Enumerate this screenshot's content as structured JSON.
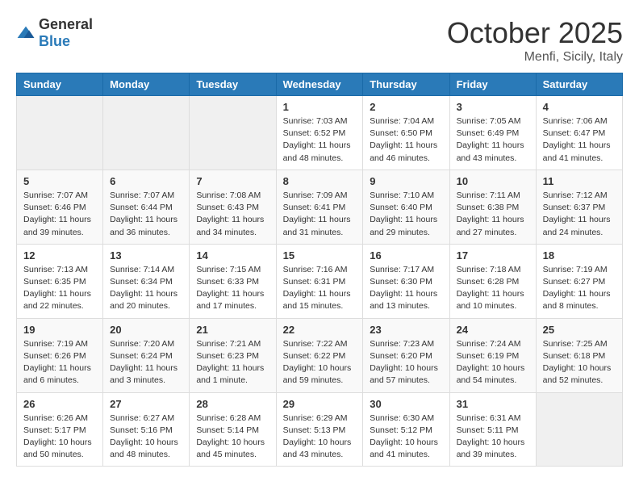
{
  "header": {
    "logo_general": "General",
    "logo_blue": "Blue",
    "month": "October 2025",
    "location": "Menfi, Sicily, Italy"
  },
  "weekdays": [
    "Sunday",
    "Monday",
    "Tuesday",
    "Wednesday",
    "Thursday",
    "Friday",
    "Saturday"
  ],
  "weeks": [
    [
      {
        "day": "",
        "info": ""
      },
      {
        "day": "",
        "info": ""
      },
      {
        "day": "",
        "info": ""
      },
      {
        "day": "1",
        "info": "Sunrise: 7:03 AM\nSunset: 6:52 PM\nDaylight: 11 hours\nand 48 minutes."
      },
      {
        "day": "2",
        "info": "Sunrise: 7:04 AM\nSunset: 6:50 PM\nDaylight: 11 hours\nand 46 minutes."
      },
      {
        "day": "3",
        "info": "Sunrise: 7:05 AM\nSunset: 6:49 PM\nDaylight: 11 hours\nand 43 minutes."
      },
      {
        "day": "4",
        "info": "Sunrise: 7:06 AM\nSunset: 6:47 PM\nDaylight: 11 hours\nand 41 minutes."
      }
    ],
    [
      {
        "day": "5",
        "info": "Sunrise: 7:07 AM\nSunset: 6:46 PM\nDaylight: 11 hours\nand 39 minutes."
      },
      {
        "day": "6",
        "info": "Sunrise: 7:07 AM\nSunset: 6:44 PM\nDaylight: 11 hours\nand 36 minutes."
      },
      {
        "day": "7",
        "info": "Sunrise: 7:08 AM\nSunset: 6:43 PM\nDaylight: 11 hours\nand 34 minutes."
      },
      {
        "day": "8",
        "info": "Sunrise: 7:09 AM\nSunset: 6:41 PM\nDaylight: 11 hours\nand 31 minutes."
      },
      {
        "day": "9",
        "info": "Sunrise: 7:10 AM\nSunset: 6:40 PM\nDaylight: 11 hours\nand 29 minutes."
      },
      {
        "day": "10",
        "info": "Sunrise: 7:11 AM\nSunset: 6:38 PM\nDaylight: 11 hours\nand 27 minutes."
      },
      {
        "day": "11",
        "info": "Sunrise: 7:12 AM\nSunset: 6:37 PM\nDaylight: 11 hours\nand 24 minutes."
      }
    ],
    [
      {
        "day": "12",
        "info": "Sunrise: 7:13 AM\nSunset: 6:35 PM\nDaylight: 11 hours\nand 22 minutes."
      },
      {
        "day": "13",
        "info": "Sunrise: 7:14 AM\nSunset: 6:34 PM\nDaylight: 11 hours\nand 20 minutes."
      },
      {
        "day": "14",
        "info": "Sunrise: 7:15 AM\nSunset: 6:33 PM\nDaylight: 11 hours\nand 17 minutes."
      },
      {
        "day": "15",
        "info": "Sunrise: 7:16 AM\nSunset: 6:31 PM\nDaylight: 11 hours\nand 15 minutes."
      },
      {
        "day": "16",
        "info": "Sunrise: 7:17 AM\nSunset: 6:30 PM\nDaylight: 11 hours\nand 13 minutes."
      },
      {
        "day": "17",
        "info": "Sunrise: 7:18 AM\nSunset: 6:28 PM\nDaylight: 11 hours\nand 10 minutes."
      },
      {
        "day": "18",
        "info": "Sunrise: 7:19 AM\nSunset: 6:27 PM\nDaylight: 11 hours\nand 8 minutes."
      }
    ],
    [
      {
        "day": "19",
        "info": "Sunrise: 7:19 AM\nSunset: 6:26 PM\nDaylight: 11 hours\nand 6 minutes."
      },
      {
        "day": "20",
        "info": "Sunrise: 7:20 AM\nSunset: 6:24 PM\nDaylight: 11 hours\nand 3 minutes."
      },
      {
        "day": "21",
        "info": "Sunrise: 7:21 AM\nSunset: 6:23 PM\nDaylight: 11 hours\nand 1 minute."
      },
      {
        "day": "22",
        "info": "Sunrise: 7:22 AM\nSunset: 6:22 PM\nDaylight: 10 hours\nand 59 minutes."
      },
      {
        "day": "23",
        "info": "Sunrise: 7:23 AM\nSunset: 6:20 PM\nDaylight: 10 hours\nand 57 minutes."
      },
      {
        "day": "24",
        "info": "Sunrise: 7:24 AM\nSunset: 6:19 PM\nDaylight: 10 hours\nand 54 minutes."
      },
      {
        "day": "25",
        "info": "Sunrise: 7:25 AM\nSunset: 6:18 PM\nDaylight: 10 hours\nand 52 minutes."
      }
    ],
    [
      {
        "day": "26",
        "info": "Sunrise: 6:26 AM\nSunset: 5:17 PM\nDaylight: 10 hours\nand 50 minutes."
      },
      {
        "day": "27",
        "info": "Sunrise: 6:27 AM\nSunset: 5:16 PM\nDaylight: 10 hours\nand 48 minutes."
      },
      {
        "day": "28",
        "info": "Sunrise: 6:28 AM\nSunset: 5:14 PM\nDaylight: 10 hours\nand 45 minutes."
      },
      {
        "day": "29",
        "info": "Sunrise: 6:29 AM\nSunset: 5:13 PM\nDaylight: 10 hours\nand 43 minutes."
      },
      {
        "day": "30",
        "info": "Sunrise: 6:30 AM\nSunset: 5:12 PM\nDaylight: 10 hours\nand 41 minutes."
      },
      {
        "day": "31",
        "info": "Sunrise: 6:31 AM\nSunset: 5:11 PM\nDaylight: 10 hours\nand 39 minutes."
      },
      {
        "day": "",
        "info": ""
      }
    ]
  ]
}
